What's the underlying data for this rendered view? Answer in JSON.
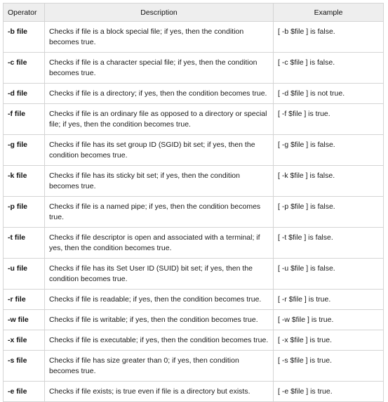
{
  "table": {
    "headers": {
      "operator": "Operator",
      "description": "Description",
      "example": "Example"
    },
    "rows": [
      {
        "operator": "-b file",
        "description": "Checks if file is a block special file; if yes, then the condition becomes true.",
        "example": "[ -b $file ] is false."
      },
      {
        "operator": "-c file",
        "description": "Checks if file is a character special file; if yes, then the condition becomes true.",
        "example": "[ -c $file ] is false."
      },
      {
        "operator": "-d file",
        "description": "Checks if file is a directory; if yes, then the condition becomes true.",
        "example": "[ -d $file ] is not true."
      },
      {
        "operator": "-f file",
        "description": "Checks if file is an ordinary file as opposed to a directory or special file; if yes, then the condition becomes true.",
        "example": "[ -f $file ] is true."
      },
      {
        "operator": "-g file",
        "description": "Checks if file has its set group ID (SGID) bit set; if yes, then the condition becomes true.",
        "example": "[ -g $file ] is false."
      },
      {
        "operator": "-k file",
        "description": "Checks if file has its sticky bit set; if yes, then the condition becomes true.",
        "example": "[ -k $file ] is false."
      },
      {
        "operator": "-p file",
        "description": "Checks if file is a named pipe; if yes, then the condition becomes true.",
        "example": "[ -p $file ] is false."
      },
      {
        "operator": "-t file",
        "description": "Checks if file descriptor is open and associated with a terminal; if yes, then the condition becomes true.",
        "example": "[ -t $file ] is false."
      },
      {
        "operator": "-u file",
        "description": "Checks if file has its Set User ID (SUID) bit set; if yes, then the condition becomes true.",
        "example": "[ -u $file ] is false."
      },
      {
        "operator": "-r file",
        "description": "Checks if file is readable; if yes, then the condition becomes true.",
        "example": "[ -r $file ] is true."
      },
      {
        "operator": "-w file",
        "description": "Checks if file is writable; if yes, then the condition becomes true.",
        "example": "[ -w $file ] is true."
      },
      {
        "operator": "-x file",
        "description": "Checks if file is executable; if yes, then the condition becomes true.",
        "example": "[ -x $file ] is true."
      },
      {
        "operator": "-s file",
        "description": "Checks if file has size greater than 0; if yes, then condition becomes true.",
        "example": "[ -s $file ] is true."
      },
      {
        "operator": "-e file",
        "description": "Checks if file exists; is true even if file is a directory but exists.",
        "example": "[ -e $file ] is true."
      }
    ]
  }
}
